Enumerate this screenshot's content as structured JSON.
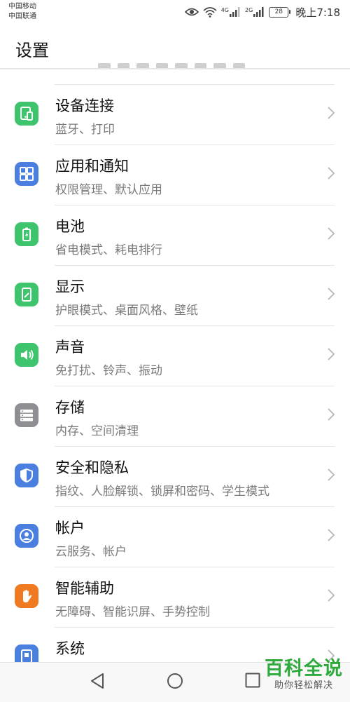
{
  "status_bar": {
    "carrier_1": "中国移动",
    "carrier_2": "中国联通",
    "network_1": "4G",
    "network_2": "2G",
    "battery": "28",
    "time": "晚上7:18",
    "icons": [
      "eye-comfort-icon",
      "wifi-icon",
      "signal-icon",
      "battery-icon"
    ]
  },
  "header": {
    "title": "设置"
  },
  "settings": [
    {
      "title": "设备连接",
      "subtitle": "蓝牙、打印",
      "icon": "device-connection-icon",
      "color": "#3ec46d"
    },
    {
      "title": "应用和通知",
      "subtitle": "权限管理、默认应用",
      "icon": "apps-icon",
      "color": "#4a7fe0"
    },
    {
      "title": "电池",
      "subtitle": "省电模式、耗电排行",
      "icon": "battery-icon",
      "color": "#3ec46d"
    },
    {
      "title": "显示",
      "subtitle": "护眼模式、桌面风格、壁纸",
      "icon": "display-icon",
      "color": "#3ec46d"
    },
    {
      "title": "声音",
      "subtitle": "免打扰、铃声、振动",
      "icon": "sound-icon",
      "color": "#3ec46d"
    },
    {
      "title": "存储",
      "subtitle": "内存、空间清理",
      "icon": "storage-icon",
      "color": "#8e8e93"
    },
    {
      "title": "安全和隐私",
      "subtitle": "指纹、人脸解锁、锁屏和密码、学生模式",
      "icon": "shield-icon",
      "color": "#4a7fe0"
    },
    {
      "title": "帐户",
      "subtitle": "云服务、帐户",
      "icon": "account-icon",
      "color": "#4a7fe0"
    },
    {
      "title": "智能辅助",
      "subtitle": "无障碍、智能识屏、手势控制",
      "icon": "hand-icon",
      "color": "#f07a22"
    },
    {
      "title": "系统",
      "subtitle": "",
      "icon": "system-icon",
      "color": "#4a7fe0"
    }
  ],
  "watermark": {
    "title": "百科全说",
    "subtitle": "助你轻松解决"
  }
}
